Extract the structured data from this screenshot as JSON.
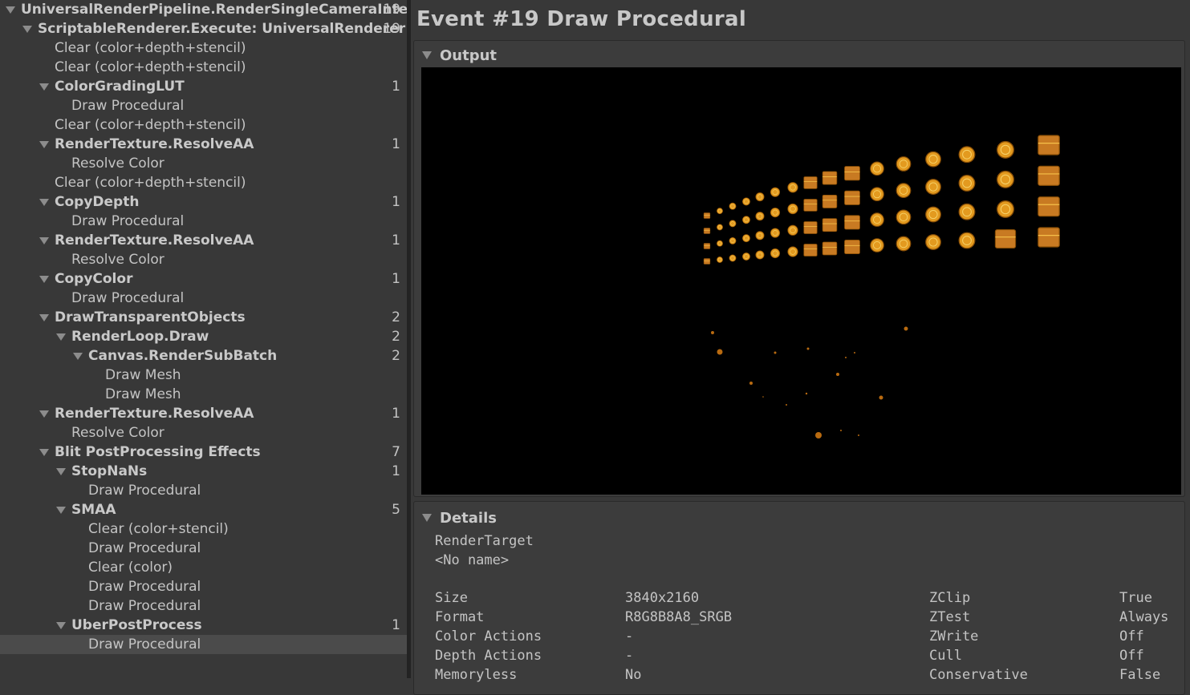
{
  "tree": [
    {
      "label": "UniversalRenderPipeline.RenderSingleCameraInter",
      "count": "19",
      "level": 0,
      "expand": true,
      "bold": true
    },
    {
      "label": "ScriptableRenderer.Execute: UniversalRenderer",
      "count": "19",
      "level": 1,
      "expand": true,
      "bold": true
    },
    {
      "label": "Clear (color+depth+stencil)",
      "count": "",
      "level": 2,
      "expand": false,
      "bold": false
    },
    {
      "label": "Clear (color+depth+stencil)",
      "count": "",
      "level": 2,
      "expand": false,
      "bold": false
    },
    {
      "label": "ColorGradingLUT",
      "count": "1",
      "level": 2,
      "expand": true,
      "bold": true
    },
    {
      "label": "Draw Procedural",
      "count": "",
      "level": 3,
      "expand": false,
      "bold": false
    },
    {
      "label": "Clear (color+depth+stencil)",
      "count": "",
      "level": 2,
      "expand": false,
      "bold": false
    },
    {
      "label": "RenderTexture.ResolveAA",
      "count": "1",
      "level": 2,
      "expand": true,
      "bold": true
    },
    {
      "label": "Resolve Color",
      "count": "",
      "level": 3,
      "expand": false,
      "bold": false
    },
    {
      "label": "Clear (color+depth+stencil)",
      "count": "",
      "level": 2,
      "expand": false,
      "bold": false
    },
    {
      "label": "CopyDepth",
      "count": "1",
      "level": 2,
      "expand": true,
      "bold": true
    },
    {
      "label": "Draw Procedural",
      "count": "",
      "level": 3,
      "expand": false,
      "bold": false
    },
    {
      "label": "RenderTexture.ResolveAA",
      "count": "1",
      "level": 2,
      "expand": true,
      "bold": true
    },
    {
      "label": "Resolve Color",
      "count": "",
      "level": 3,
      "expand": false,
      "bold": false
    },
    {
      "label": "CopyColor",
      "count": "1",
      "level": 2,
      "expand": true,
      "bold": true
    },
    {
      "label": "Draw Procedural",
      "count": "",
      "level": 3,
      "expand": false,
      "bold": false
    },
    {
      "label": "DrawTransparentObjects",
      "count": "2",
      "level": 2,
      "expand": true,
      "bold": true
    },
    {
      "label": "RenderLoop.Draw",
      "count": "2",
      "level": 3,
      "expand": true,
      "bold": true
    },
    {
      "label": "Canvas.RenderSubBatch",
      "count": "2",
      "level": 4,
      "expand": true,
      "bold": true
    },
    {
      "label": "Draw Mesh",
      "count": "",
      "level": 5,
      "expand": false,
      "bold": false
    },
    {
      "label": "Draw Mesh",
      "count": "",
      "level": 5,
      "expand": false,
      "bold": false
    },
    {
      "label": "RenderTexture.ResolveAA",
      "count": "1",
      "level": 2,
      "expand": true,
      "bold": true
    },
    {
      "label": "Resolve Color",
      "count": "",
      "level": 3,
      "expand": false,
      "bold": false
    },
    {
      "label": "Blit PostProcessing Effects",
      "count": "7",
      "level": 2,
      "expand": true,
      "bold": true
    },
    {
      "label": "StopNaNs",
      "count": "1",
      "level": 3,
      "expand": true,
      "bold": true
    },
    {
      "label": "Draw Procedural",
      "count": "",
      "level": 4,
      "expand": false,
      "bold": false
    },
    {
      "label": "SMAA",
      "count": "5",
      "level": 3,
      "expand": true,
      "bold": true
    },
    {
      "label": "Clear (color+stencil)",
      "count": "",
      "level": 4,
      "expand": false,
      "bold": false
    },
    {
      "label": "Draw Procedural",
      "count": "",
      "level": 4,
      "expand": false,
      "bold": false
    },
    {
      "label": "Clear (color)",
      "count": "",
      "level": 4,
      "expand": false,
      "bold": false
    },
    {
      "label": "Draw Procedural",
      "count": "",
      "level": 4,
      "expand": false,
      "bold": false
    },
    {
      "label": "Draw Procedural",
      "count": "",
      "level": 4,
      "expand": false,
      "bold": false
    },
    {
      "label": "UberPostProcess",
      "count": "1",
      "level": 3,
      "expand": true,
      "bold": true
    },
    {
      "label": "Draw Procedural",
      "count": "",
      "level": 4,
      "expand": false,
      "bold": false,
      "selected": true
    }
  ],
  "event": {
    "title": "Event #19 Draw Procedural"
  },
  "output": {
    "header": "Output"
  },
  "details": {
    "header": "Details",
    "render_target_label": "RenderTarget",
    "render_target_name": "<No name>",
    "left": [
      {
        "key": "Size",
        "value": "3840x2160"
      },
      {
        "key": "Format",
        "value": "R8G8B8A8_SRGB"
      },
      {
        "key": "Color Actions",
        "value": "-"
      },
      {
        "key": "Depth Actions",
        "value": "-"
      },
      {
        "key": "Memoryless",
        "value": "No"
      }
    ],
    "right": [
      {
        "key": "ZClip",
        "value": "True"
      },
      {
        "key": "ZTest",
        "value": "Always"
      },
      {
        "key": "ZWrite",
        "value": "Off"
      },
      {
        "key": "Cull",
        "value": "Off"
      },
      {
        "key": "Conservative",
        "value": "False"
      }
    ]
  },
  "colors": {
    "coin": "#e39a1f",
    "coin_dark": "#8a4f06",
    "chest": "#c87a22",
    "panel": "#383838",
    "selected": "#4b4b4b"
  }
}
